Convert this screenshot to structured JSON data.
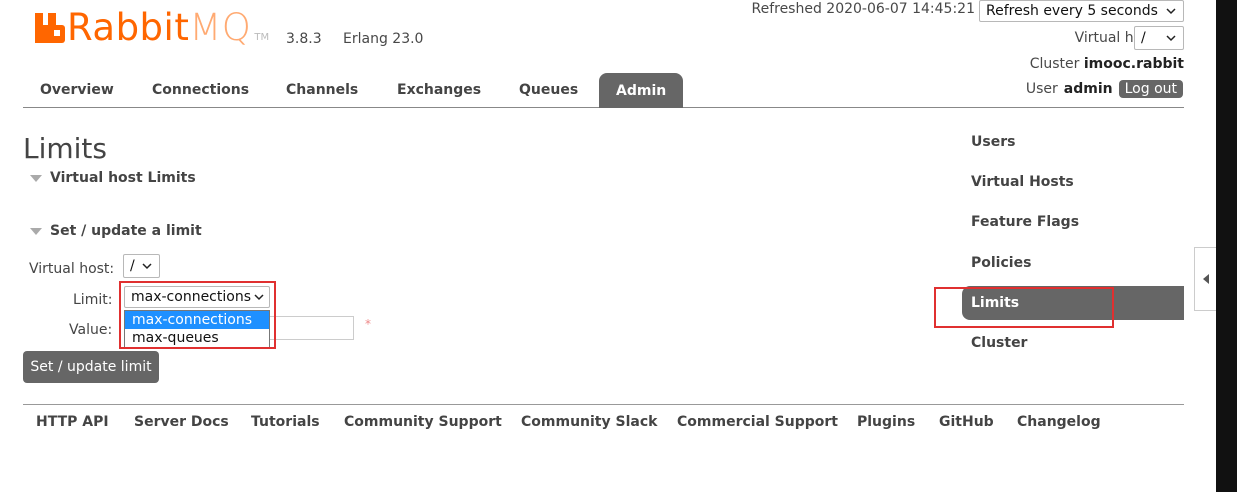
{
  "brand": {
    "name_part1": "Rabbit",
    "name_part2": "MQ",
    "tm": "TM",
    "version": "3.8.3",
    "erlang": "Erlang 23.0"
  },
  "header": {
    "refreshed": "Refreshed 2020-06-07 14:45:21",
    "refresh_select": "Refresh every 5 seconds",
    "vhost_label": "Virtual host",
    "vhost_value": "/",
    "cluster_label": "Cluster",
    "cluster_name": "imooc.rabbit",
    "user_label": "User",
    "user_name": "admin",
    "logout": "Log out"
  },
  "nav": {
    "tabs": [
      "Overview",
      "Connections",
      "Channels",
      "Exchanges",
      "Queues",
      "Admin"
    ],
    "active": "Admin"
  },
  "page": {
    "title": "Limits",
    "section_vhost_limits": "Virtual host Limits",
    "section_set_limit": "Set / update a limit",
    "form": {
      "vhost_label": "Virtual host:",
      "vhost_value": "/",
      "limit_label": "Limit:",
      "limit_value": "max-connections",
      "limit_options": [
        "max-connections",
        "max-queues"
      ],
      "value_label": "Value:",
      "required_mark": "*",
      "submit": "Set / update limit"
    }
  },
  "sidebar": {
    "items": [
      "Users",
      "Virtual Hosts",
      "Feature Flags",
      "Policies",
      "Limits",
      "Cluster"
    ],
    "active": "Limits"
  },
  "footer": {
    "links": [
      "HTTP API",
      "Server Docs",
      "Tutorials",
      "Community Support",
      "Community Slack",
      "Commercial Support",
      "Plugins",
      "GitHub",
      "Changelog"
    ]
  },
  "colors": {
    "brand": "#ff6600",
    "tab_active": "#666666",
    "highlight": "#e03030",
    "option_selected": "#1e90ff"
  }
}
